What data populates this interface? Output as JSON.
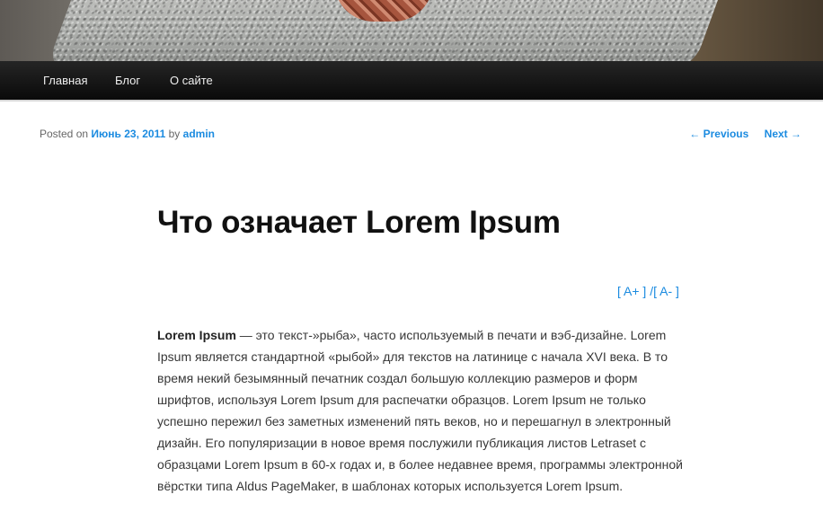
{
  "nav": {
    "items": [
      "Главная",
      "Блог",
      "О сайте"
    ]
  },
  "meta": {
    "posted_on": "Posted on",
    "date": "Июнь 23, 2011",
    "by": "by",
    "author": "admin"
  },
  "postnav": {
    "previous": "← Previous",
    "next": "Next →"
  },
  "post": {
    "title": "Что означает Lorem Ipsum",
    "lead_bold": "Lorem Ipsum",
    "body": " — это текст-»рыба», часто используемый в печати и вэб-дизайне. Lorem Ipsum является стандартной «рыбой» для текстов на латинице с начала XVI века. В то время некий безымянный печатник создал большую коллекцию размеров и форм шрифтов, используя Lorem Ipsum для распечатки образцов. Lorem Ipsum не только успешно пережил без заметных изменений пять веков, но и перешагнул в электронный дизайн. Его популяризации в новое время послужили публикация листов Letraset с образцами Lorem Ipsum в 60-х годах и, в более недавнее время, программы электронной вёрстки типа Aldus PageMaker, в шаблонах которых используется Lorem Ipsum."
  },
  "font_controls": {
    "increase": "[ A+ ]",
    "separator": " /",
    "decrease": "[ A- ]"
  },
  "colors": {
    "link": "#1b8be0",
    "navbar": "#1a1a1a"
  }
}
